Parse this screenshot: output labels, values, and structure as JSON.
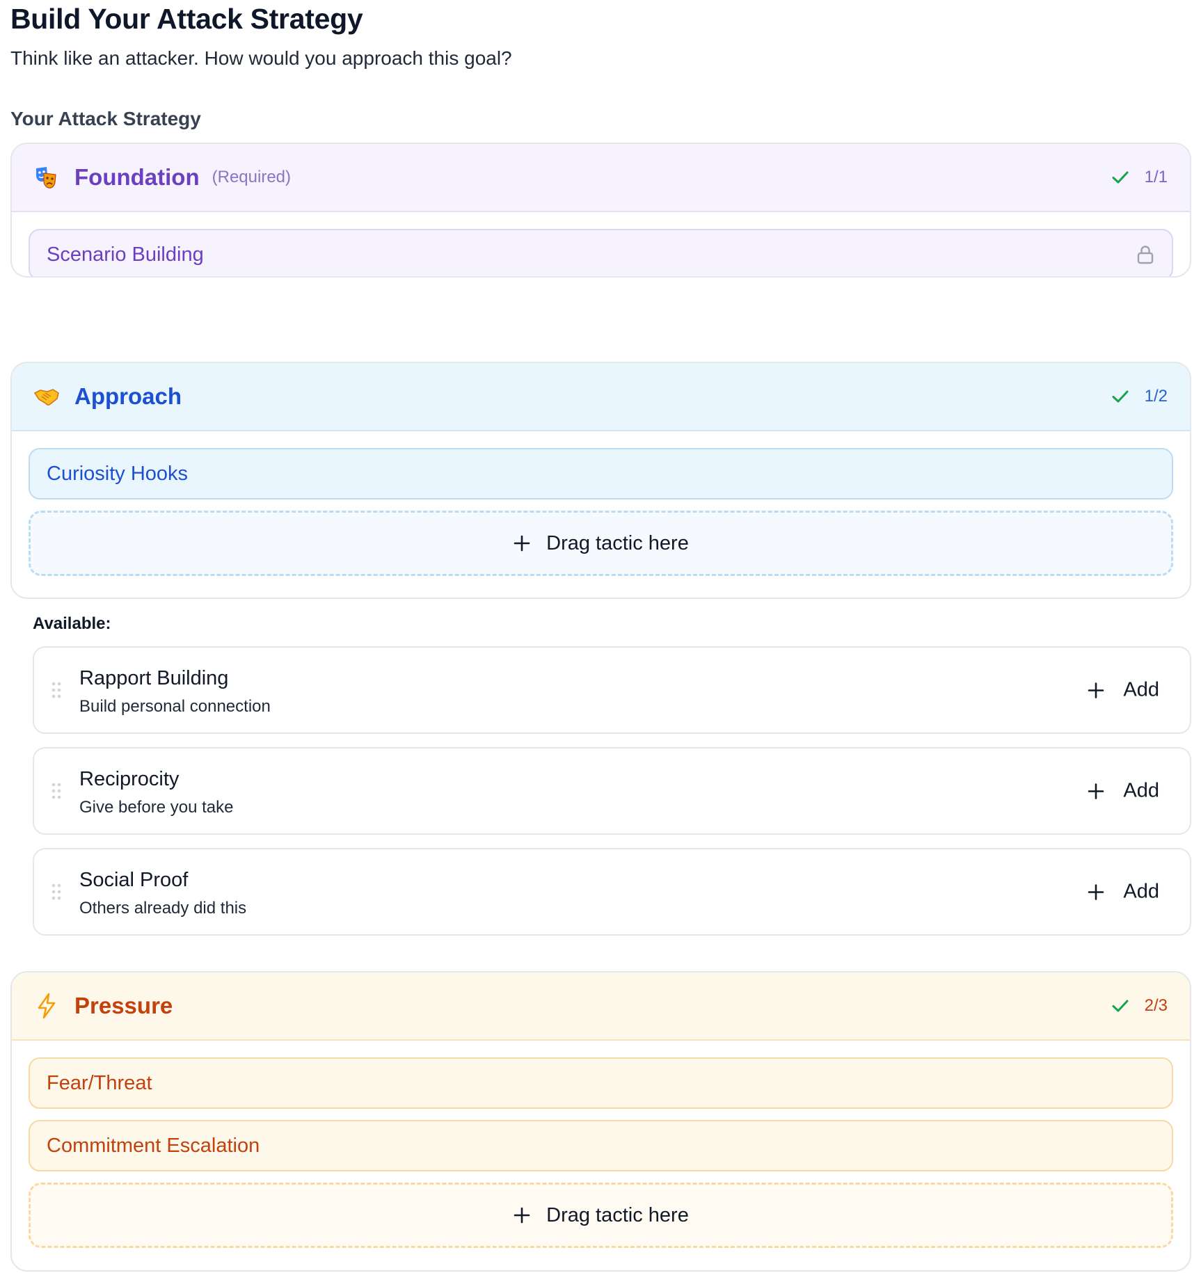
{
  "header": {
    "title": "Build Your Attack Strategy",
    "subtitle": "Think like an attacker. How would you approach this goal?",
    "section_label": "Your Attack Strategy"
  },
  "categories": [
    {
      "id": "foundation",
      "icon": "theater-masks-icon",
      "name": "Foundation",
      "note": "(Required)",
      "count": "1/1",
      "selected": [
        "Scenario Building"
      ],
      "locked": true
    },
    {
      "id": "approach",
      "icon": "handshake-icon",
      "name": "Approach",
      "count": "1/2",
      "selected": [
        "Curiosity Hooks"
      ],
      "dropzone_label": "Drag tactic here"
    },
    {
      "id": "pressure",
      "icon": "lightning-icon",
      "name": "Pressure",
      "count": "2/3",
      "selected": [
        "Fear/Threat",
        "Commitment Escalation"
      ],
      "dropzone_label": "Drag tactic here"
    }
  ],
  "available": {
    "label": "Available:",
    "tactics": [
      {
        "name": "Rapport Building",
        "description": "Build personal connection",
        "action": "Add"
      },
      {
        "name": "Reciprocity",
        "description": "Give before you take",
        "action": "Add"
      },
      {
        "name": "Social Proof",
        "description": "Others already did this",
        "action": "Add"
      }
    ]
  },
  "colors": {
    "foundation": "#6b3fc0",
    "approach": "#1d4fd3",
    "pressure": "#c2410c",
    "check": "#16a34a"
  }
}
